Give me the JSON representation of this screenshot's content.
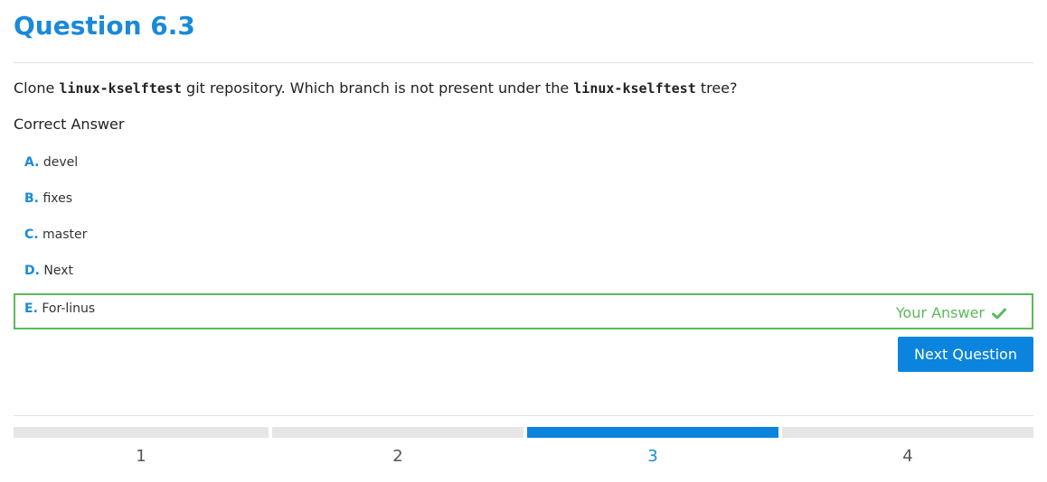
{
  "header": {
    "title": "Question 6.3"
  },
  "question": {
    "parts": [
      "Clone ",
      "linux-kselftest",
      " git repository. Which branch is not present under the ",
      "linux-kselftest",
      " tree?"
    ]
  },
  "correct_answer_label": "Correct Answer",
  "options": [
    {
      "letter": "A.",
      "text": "devel"
    },
    {
      "letter": "B.",
      "text": "fixes"
    },
    {
      "letter": "C.",
      "text": "master"
    },
    {
      "letter": "D.",
      "text": "Next"
    },
    {
      "letter": "E.",
      "text": "For-linus",
      "selected": true,
      "badge": "Your Answer"
    }
  ],
  "next_button": {
    "label": "Next Question"
  },
  "progress": {
    "steps": [
      "1",
      "2",
      "3",
      "4"
    ],
    "active_step": "3"
  },
  "colors": {
    "accent": "#1a8ad8",
    "button": "#0a84dc",
    "success": "#5cb85c"
  },
  "icons": {
    "your_answer": "check-icon"
  }
}
